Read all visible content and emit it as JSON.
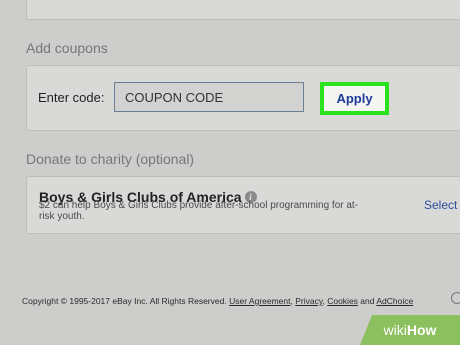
{
  "coupons": {
    "title": "Add coupons",
    "enter_label": "Enter code:",
    "input_value": "COUPON CODE",
    "apply_label": "Apply",
    "highlight_color": "#29e31f"
  },
  "charity": {
    "title": "Donate to charity (optional)",
    "name": "Boys & Girls Clubs of America",
    "info_icon": "info-icon",
    "description": "$2 can help Boys & Girls Clubs provide after-school programming for at-risk youth.",
    "select_label": "Select"
  },
  "footer": {
    "copyright": "Copyright © 1995-2017 eBay Inc. All Rights Reserved. ",
    "user_agreement": "User Agreement",
    "sep1": ", ",
    "privacy": "Privacy",
    "sep2": ", ",
    "cookies": "Cookies",
    "and": " and ",
    "adchoice": "AdChoice"
  },
  "watermark": {
    "wiki": "wiki",
    "how": "How"
  }
}
